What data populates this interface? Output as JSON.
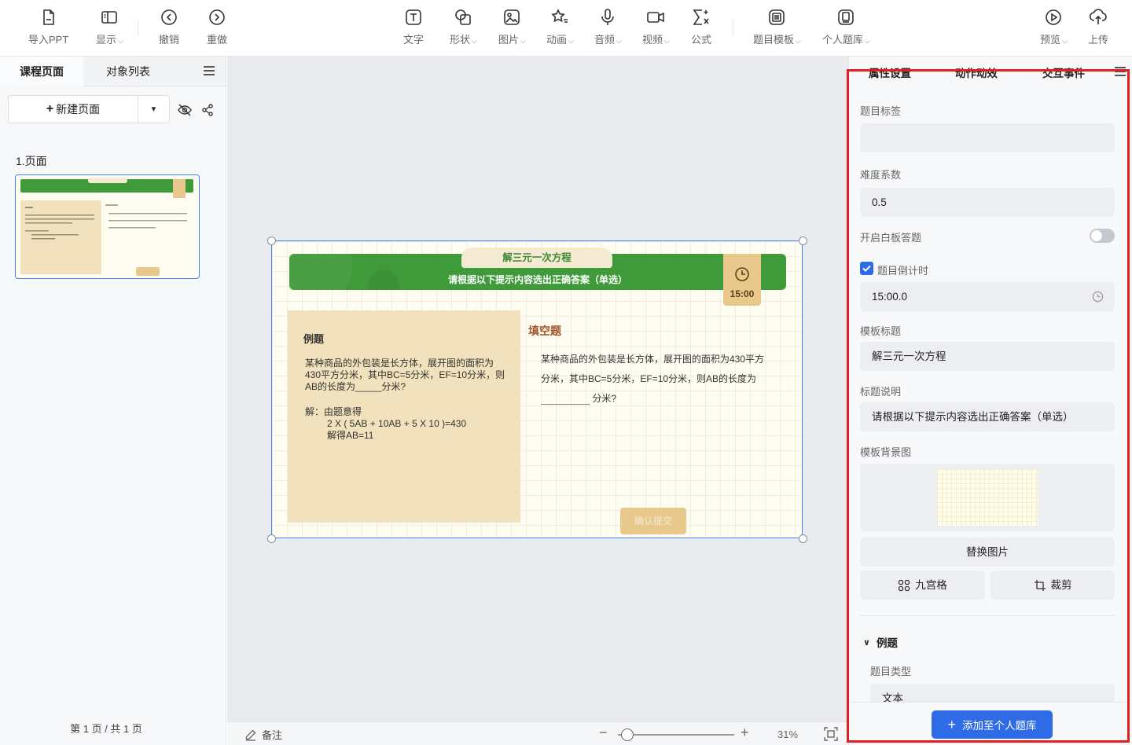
{
  "toolbar": {
    "import_ppt": "导入PPT",
    "display": "显示",
    "undo": "撤销",
    "redo": "重做",
    "text": "文字",
    "shape": "形状",
    "image": "图片",
    "animation": "动画",
    "audio": "音频",
    "video": "视频",
    "formula": "公式",
    "question_template": "题目模板",
    "personal_bank": "个人题库",
    "preview": "预览",
    "upload": "上传"
  },
  "left_panel": {
    "tabs": [
      "课程页面",
      "对象列表"
    ],
    "new_page_label": "新建页面",
    "page_label": "1.页面",
    "page_count": "第 1 页 / 共 1 页"
  },
  "slide": {
    "title": "解三元一次方程",
    "subtitle": "请根据以下提示内容选出正确答案（单选）",
    "timer": "15:00",
    "example_heading": "例题",
    "example_question": "某种商品的外包装是长方体，展开图的面积为430平方分米，其中BC=5分米，EF=10分米，则AB的长度为_____分米?",
    "solution_lines": [
      "解：由题意得",
      "2 X ( 5AB + 10AB + 5 X 10 )=430",
      "解得AB=11"
    ],
    "fill_heading": "填空题",
    "fill_text_before": "某种商品的外包装是长方体，展开图的面积为430平方分米，其中BC=5分米，EF=10分米，则AB的长度为",
    "fill_text_after": "分米?",
    "submit_label": "确认提交"
  },
  "bottom_bar": {
    "note_label": "备注",
    "zoom": "31%"
  },
  "right_panel": {
    "tabs": [
      "属性设置",
      "动作动效",
      "交互事件"
    ],
    "question_tag_label": "题目标签",
    "question_tag_value": "",
    "difficulty_label": "难度系数",
    "difficulty_value": "0.5",
    "whiteboard_label": "开启白板答题",
    "whiteboard_on": false,
    "countdown_label": "题目倒计时",
    "countdown_checked": true,
    "countdown_value": "15:00.0",
    "template_title_label": "模板标题",
    "template_title_value": "解三元一次方程",
    "title_desc_label": "标题说明",
    "title_desc_value": "请根据以下提示内容选出正确答案（单选）",
    "bg_label": "模板背景图",
    "replace_image": "替换图片",
    "nine_grid": "九宫格",
    "crop": "裁剪",
    "section_example": "例题",
    "question_type_label": "题目类型",
    "question_type_value": "文本",
    "add_to_bank": "添加至个人题库"
  },
  "colors": {
    "accent_blue": "#2f6be6",
    "banner_green": "#3f9a3a",
    "card_tan": "#f1e1bc",
    "highlight_red": "#e02020"
  }
}
